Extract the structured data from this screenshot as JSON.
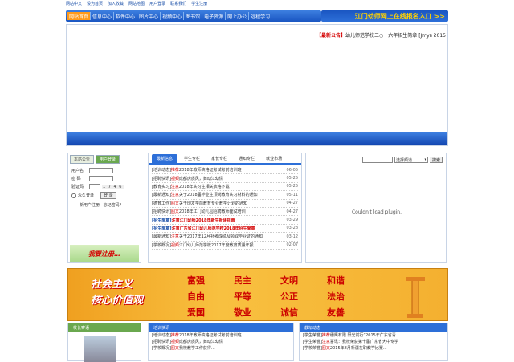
{
  "top_links": [
    "网站中文",
    "设为首页",
    "加入收藏",
    "网站地图",
    "用户登录",
    "联系我们",
    "学生注册"
  ],
  "nav": {
    "items": [
      "网站首页",
      "信息中心",
      "软件中心",
      "图片中心",
      "视频中心",
      "图书馆",
      "电子资源",
      "网上办公",
      "远程学习"
    ]
  },
  "banner": {
    "text": "江门幼师网上在线报名入口 >>"
  },
  "notice": {
    "tag": "【最新公告】",
    "text": "幼儿师范学校二○一六年招生简章 [Jmys 2015"
  },
  "login": {
    "tabs": [
      "本站公告",
      "用户登录"
    ],
    "username_label": "用户名",
    "password_label": "密  码",
    "captcha_label": "验证码",
    "captcha_value": "1 7 4 6",
    "remember_label": "永久登录",
    "login_button": "登 录",
    "register_link": "新用户注册",
    "forgot_link": "忘记密码？",
    "signup_banner": "我要注册…"
  },
  "news": {
    "tabs": [
      "最新信息",
      "学生专栏",
      "家长专栏",
      "通知专栏",
      "就业市场"
    ],
    "rows": [
      {
        "prefix": "[培训动态]",
        "cat": "推荐",
        "title": "2018年教师资格证考试考前培训班",
        "date": "06-05",
        "hl": false
      },
      {
        "prefix": "[招聘快讯]",
        "cat": "视频",
        "title": "成都虎质风，舞动江幼情",
        "date": "05-25",
        "hl": false
      },
      {
        "prefix": "[教育实习]",
        "cat": "注意",
        "title": "2018年实习生相关表格下载",
        "date": "05-25",
        "hl": false
      },
      {
        "prefix": "[最新通知]",
        "cat": "注意",
        "title": "关于2018届毕业生顶岗教育实习材料的通知",
        "date": "05-11",
        "hl": false
      },
      {
        "prefix": "[德育工作]",
        "cat": "图文",
        "title": "关于印发学前教育专业教学计划的通知",
        "date": "04-27",
        "hl": false
      },
      {
        "prefix": "[招聘快讯]",
        "cat": "图文",
        "title": "2018年江门幼儿园招聘教师面试培训",
        "date": "04-27",
        "hl": false
      },
      {
        "prefix": "[招生简章]",
        "cat": "注意",
        "title": "江门幼师2018年新生报读指南",
        "date": "03-29",
        "hl": true
      },
      {
        "prefix": "[招生简章]",
        "cat": "注意",
        "title": "广东省江门幼儿师范学校2018年招生简章",
        "date": "03-28",
        "hl": true
      },
      {
        "prefix": "[最新通知]",
        "cat": "注意",
        "title": "关于2017年12月补考成绩及领取毕业证的通知",
        "date": "03-12",
        "hl": false
      },
      {
        "prefix": "[学校概况]",
        "cat": "视频",
        "title": "江门幼儿师范学校2017年度教育质量年报",
        "date": "02-07",
        "hl": false
      }
    ]
  },
  "plugin": {
    "search_select": "选择频道",
    "search_button": "搜索",
    "message": "Couldn't load plugin."
  },
  "values": {
    "left_line1": "社会主义",
    "left_line2": "核心价值观",
    "words": [
      "富强",
      "民主",
      "文明",
      "和谐",
      "自由",
      "平等",
      "公正",
      "法治",
      "爱国",
      "敬业",
      "诚信",
      "友善"
    ]
  },
  "bottom": {
    "p1": {
      "title": "校长寄语"
    },
    "p2": {
      "title": "培训快讯",
      "rows": [
        {
          "prefix": "[培训动态]",
          "cat": "推荐",
          "title": "2018年教师资格证考试考前培训班"
        },
        {
          "prefix": "[招聘快讯]",
          "cat": "视频",
          "title": "成都虎质风，舞动江幼情"
        },
        {
          "prefix": "[学校概况]",
          "cat": "图文",
          "title": "我校教学工作获得..."
        }
      ]
    },
    "p3": {
      "title": "教坛动态",
      "rows": [
        {
          "prefix": "[学生荣誉]",
          "cat": "推荐",
          "title": "穗鹰有限 阳光前行”2015年广东省青"
        },
        {
          "prefix": "[学生荣誉]",
          "cat": "注意",
          "title": "喜讯：我校荣获第十届广东省大中专学"
        },
        {
          "prefix": "[学校荣誉]",
          "cat": "图文",
          "title": "2015年8月新疆在职教学比赛..."
        }
      ]
    }
  }
}
